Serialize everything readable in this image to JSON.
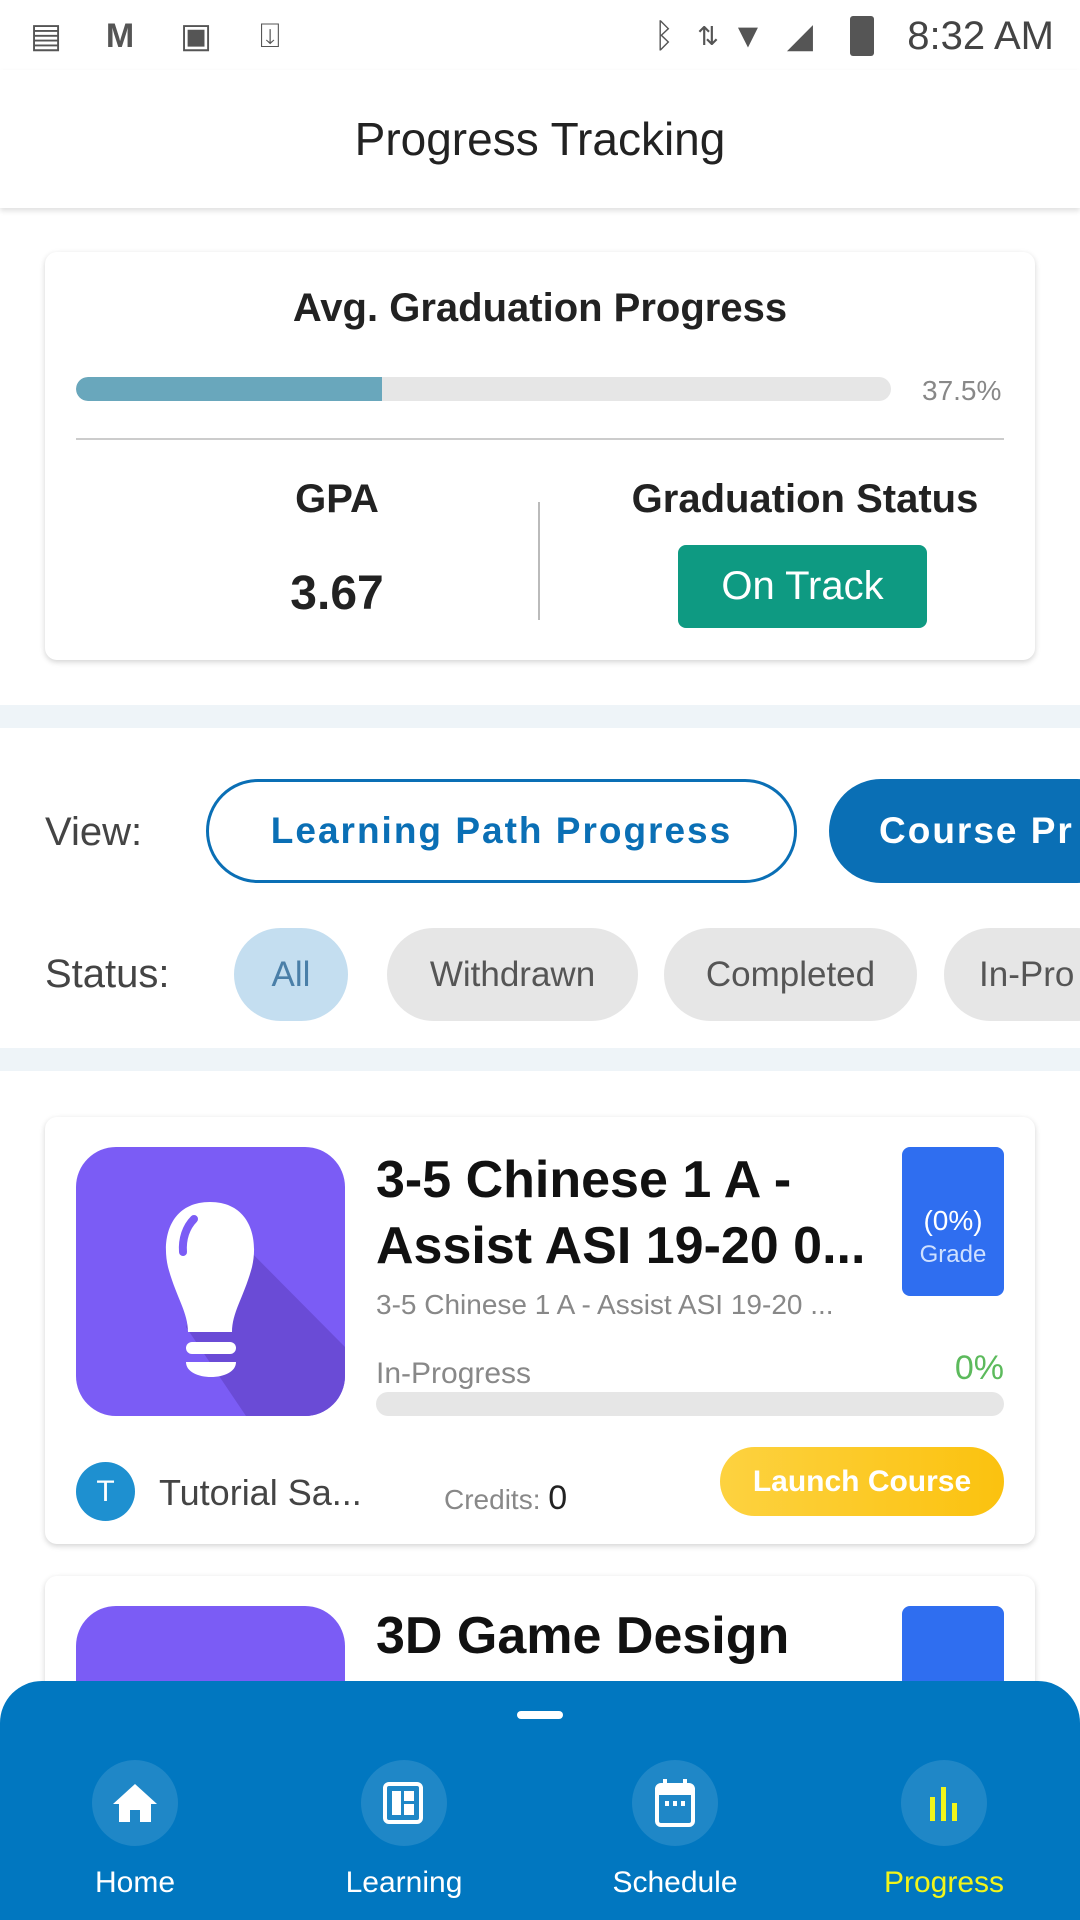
{
  "status_bar": {
    "time": "8:32 AM",
    "left_icons": [
      "notes-icon",
      "gmail-icon",
      "image-icon",
      "download-icon"
    ],
    "right_icons": [
      "bluetooth-icon",
      "data-arrows-icon",
      "wifi-icon",
      "signal-icon",
      "battery-icon"
    ]
  },
  "header": {
    "title": "Progress Tracking"
  },
  "summary": {
    "title": "Avg. Graduation Progress",
    "progress_percent": 37.5,
    "progress_label": "37.5%",
    "gpa_label": "GPA",
    "gpa_value": "3.67",
    "status_label": "Graduation Status",
    "status_value": "On Track"
  },
  "filters": {
    "view_label": "View:",
    "view_options": [
      "Learning Path Progress",
      "Course Pr"
    ],
    "status_label": "Status:",
    "status_options": [
      "All",
      "Withdrawn",
      "Completed",
      "In-Pro"
    ]
  },
  "courses": [
    {
      "title": "3-5 Chinese 1 A - Assist ASI 19-20 0...",
      "subtitle": "3-5 Chinese 1 A - Assist ASI 19-20 ...",
      "grade_value": "(0%)",
      "grade_label": "Grade",
      "status": "In-Progress",
      "progress_label": "0%",
      "progress_percent": 0,
      "instructor_initial": "T",
      "instructor": "Tutorial Sa...",
      "credits_label": "Credits:",
      "credits_value": "0",
      "launch_label": "Launch Course"
    },
    {
      "title": "3D Game Design"
    }
  ],
  "bottom_nav": [
    {
      "label": "Home",
      "icon": "home-icon"
    },
    {
      "label": "Learning",
      "icon": "notebook-icon"
    },
    {
      "label": "Schedule",
      "icon": "calendar-icon"
    },
    {
      "label": "Progress",
      "icon": "bar-chart-icon",
      "active": true
    }
  ],
  "colors": {
    "accent": "#0177c0",
    "on_track": "#0e9a82",
    "launch": "#fcc628",
    "course_icon": "#7b5cf5",
    "grade_box": "#2f6ef0",
    "active_nav": "#f2f51a",
    "progress_fill": "#69a7bc"
  }
}
